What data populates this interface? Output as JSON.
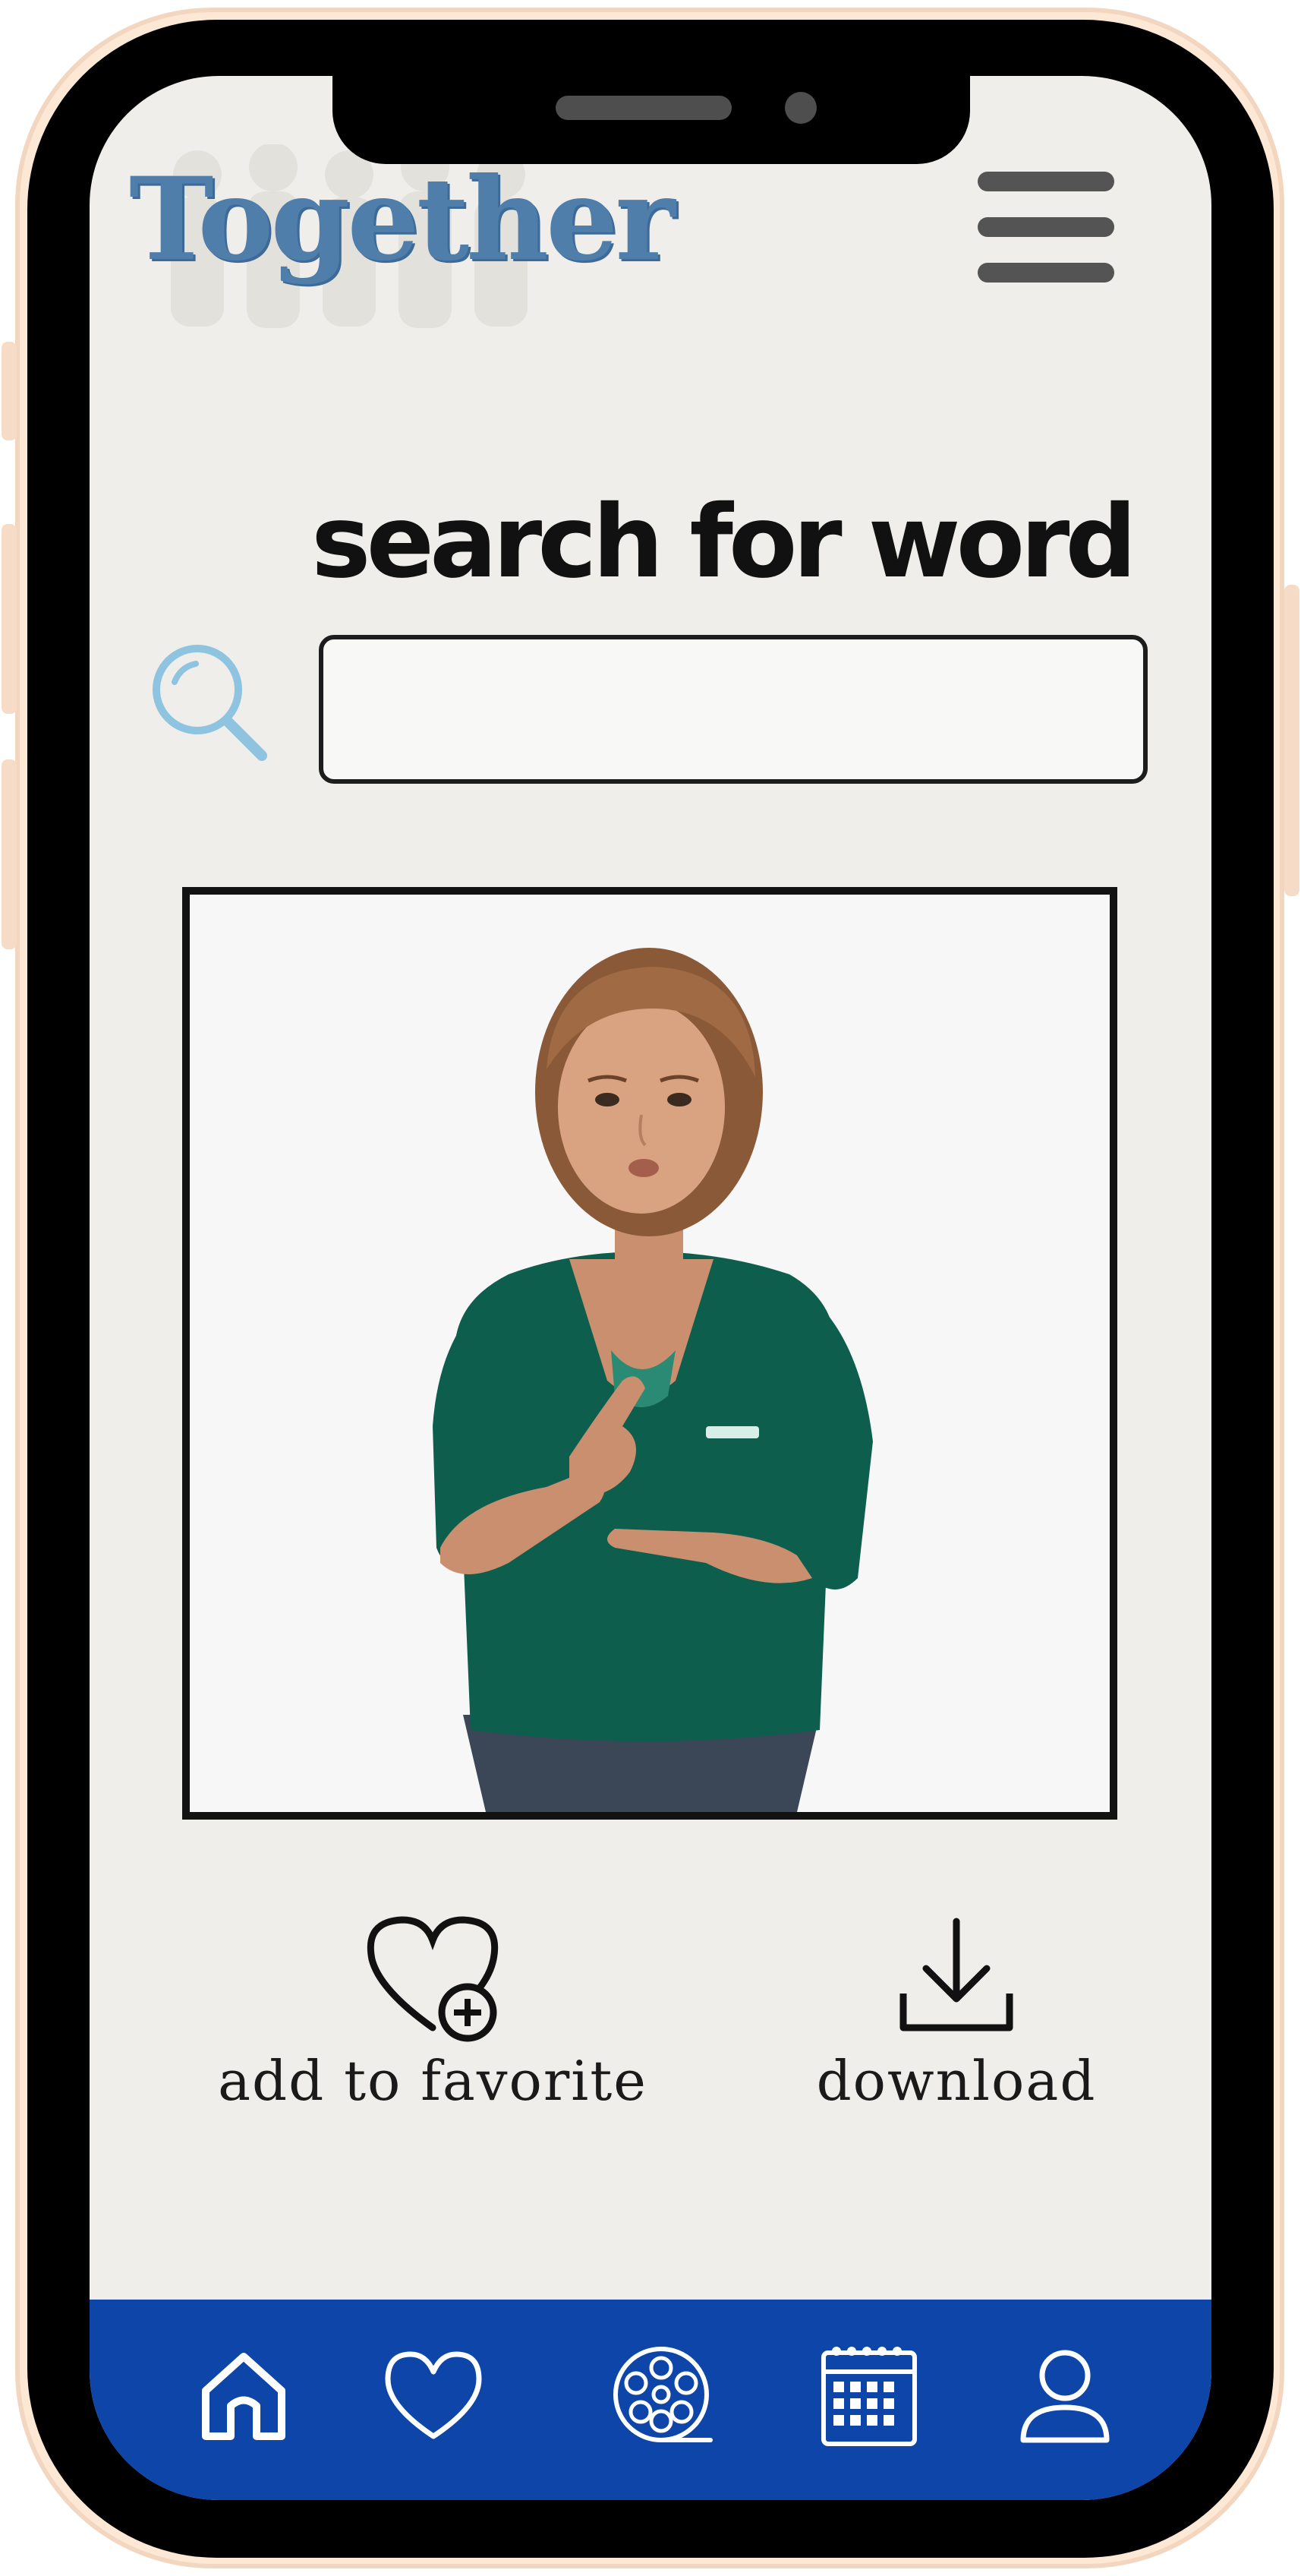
{
  "app": {
    "logo_text": "Together"
  },
  "header": {
    "menu_icon": "hamburger-menu-icon"
  },
  "search": {
    "label": "search for word",
    "value": "",
    "placeholder": "",
    "icon": "search-icon",
    "icon_color": "#8ec4e0"
  },
  "video": {
    "description_icon": "sign-language-avatar"
  },
  "actions": {
    "favorite_label": "add to favorite",
    "favorite_icon": "heart-plus-icon",
    "download_label": "download",
    "download_icon": "download-icon"
  },
  "bottom_nav": {
    "items": [
      {
        "icon": "home-icon"
      },
      {
        "icon": "heart-icon"
      },
      {
        "icon": "film-reel-icon"
      },
      {
        "icon": "calendar-icon"
      },
      {
        "icon": "user-icon"
      }
    ],
    "color": "#0e45a8"
  },
  "colors": {
    "screen_bg": "#efeeea",
    "logo": "#4f7eab",
    "phone_case": "#fde8d6"
  }
}
